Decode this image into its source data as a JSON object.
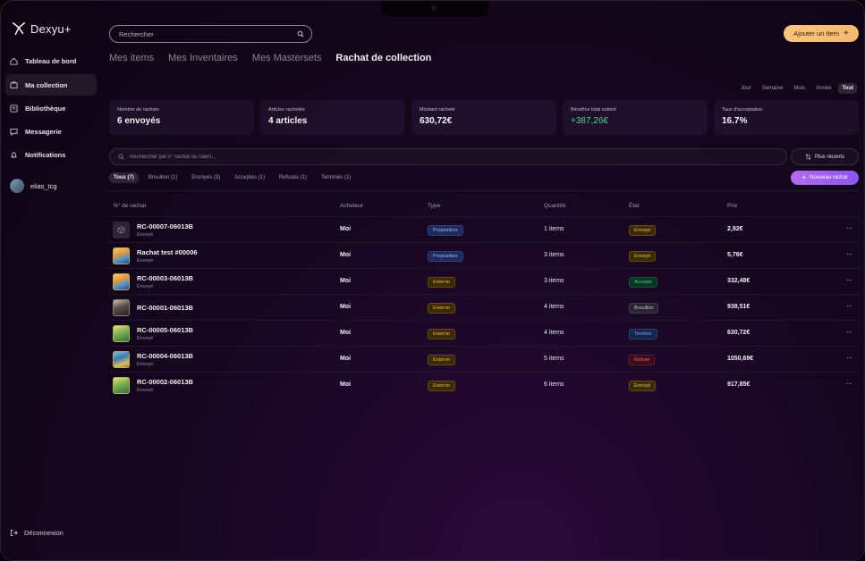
{
  "app": {
    "name": "Dexyu+",
    "accent": "#f4b96e",
    "primary": "#8a55ec"
  },
  "sidebar": {
    "items": [
      {
        "label": "Tableau de bord",
        "icon": "home-icon"
      },
      {
        "label": "Ma collection",
        "icon": "collection-icon",
        "active": true
      },
      {
        "label": "Bibliothèque",
        "icon": "library-icon"
      },
      {
        "label": "Messagerie",
        "icon": "message-icon"
      },
      {
        "label": "Notifications",
        "icon": "bell-icon"
      }
    ],
    "user": "elias_tcg",
    "logout": "Déconnexion"
  },
  "header": {
    "search_placeholder": "Rechercher",
    "add_button": "Ajouter un Item"
  },
  "tabs": [
    "Mes items",
    "Mes Inventaires",
    "Mes Mastersets",
    "Rachat de collection"
  ],
  "periods": [
    "Jour",
    "Semaine",
    "Mois",
    "Année",
    "Tout"
  ],
  "stats": [
    {
      "label": "Nombre de rachats",
      "value": "6 envoyés"
    },
    {
      "label": "Articles rachetés",
      "value": "4 articles"
    },
    {
      "label": "Montant racheté",
      "value": "630,72€"
    },
    {
      "label": "Bénéfice total estimé",
      "value": "+387,26€",
      "color": "#4ad28a"
    },
    {
      "label": "Taux d'acceptation",
      "value": "16.7%"
    }
  ],
  "filters": {
    "search_placeholder": "Rechercher par n° rachat ou client...",
    "sort": "Plus récents",
    "chips": [
      "Tous (7)",
      "Brouillon (1)",
      "Envoyés (3)",
      "Acceptés (1)",
      "Refusés (1)",
      "Terminés (1)"
    ],
    "new_button": "Nouveau rachat"
  },
  "table": {
    "columns": [
      "N° de rachat",
      "Acheteur",
      "Type",
      "Quantité",
      "État",
      "Prix"
    ],
    "rows": [
      {
        "id": "RC-00007-06013B",
        "sub": "Envoyé",
        "buyer": "Moi",
        "type": "Proposition",
        "qty": "1 items",
        "state": "Envoyé",
        "price": "2,92€"
      },
      {
        "id": "Rachat test #00006",
        "sub": "Envoyé",
        "buyer": "Moi",
        "type": "Proposition",
        "qty": "3 items",
        "state": "Envoyé",
        "price": "5,76€"
      },
      {
        "id": "RC-00003-06013B",
        "sub": "Envoyé",
        "buyer": "Moi",
        "type": "Externe",
        "qty": "3 items",
        "state": "Accepté",
        "price": "332,48€"
      },
      {
        "id": "RC-00001-06013B",
        "sub": "",
        "buyer": "Moi",
        "type": "Externe",
        "qty": "4 items",
        "state": "Brouillon",
        "price": "938,51€"
      },
      {
        "id": "RC-00005-06013B",
        "sub": "Envoyé",
        "buyer": "Moi",
        "type": "Externe",
        "qty": "4 items",
        "state": "Terminé",
        "price": "630,72€"
      },
      {
        "id": "RC-00004-06013B",
        "sub": "Envoyé",
        "buyer": "Moi",
        "type": "Externe",
        "qty": "5 items",
        "state": "Refusé",
        "price": "1050,69€"
      },
      {
        "id": "RC-00002-06013B",
        "sub": "Envoyé",
        "buyer": "Moi",
        "type": "Externe",
        "qty": "6 items",
        "state": "Envoyé",
        "price": "917,85€"
      }
    ],
    "more_icon": "···"
  }
}
